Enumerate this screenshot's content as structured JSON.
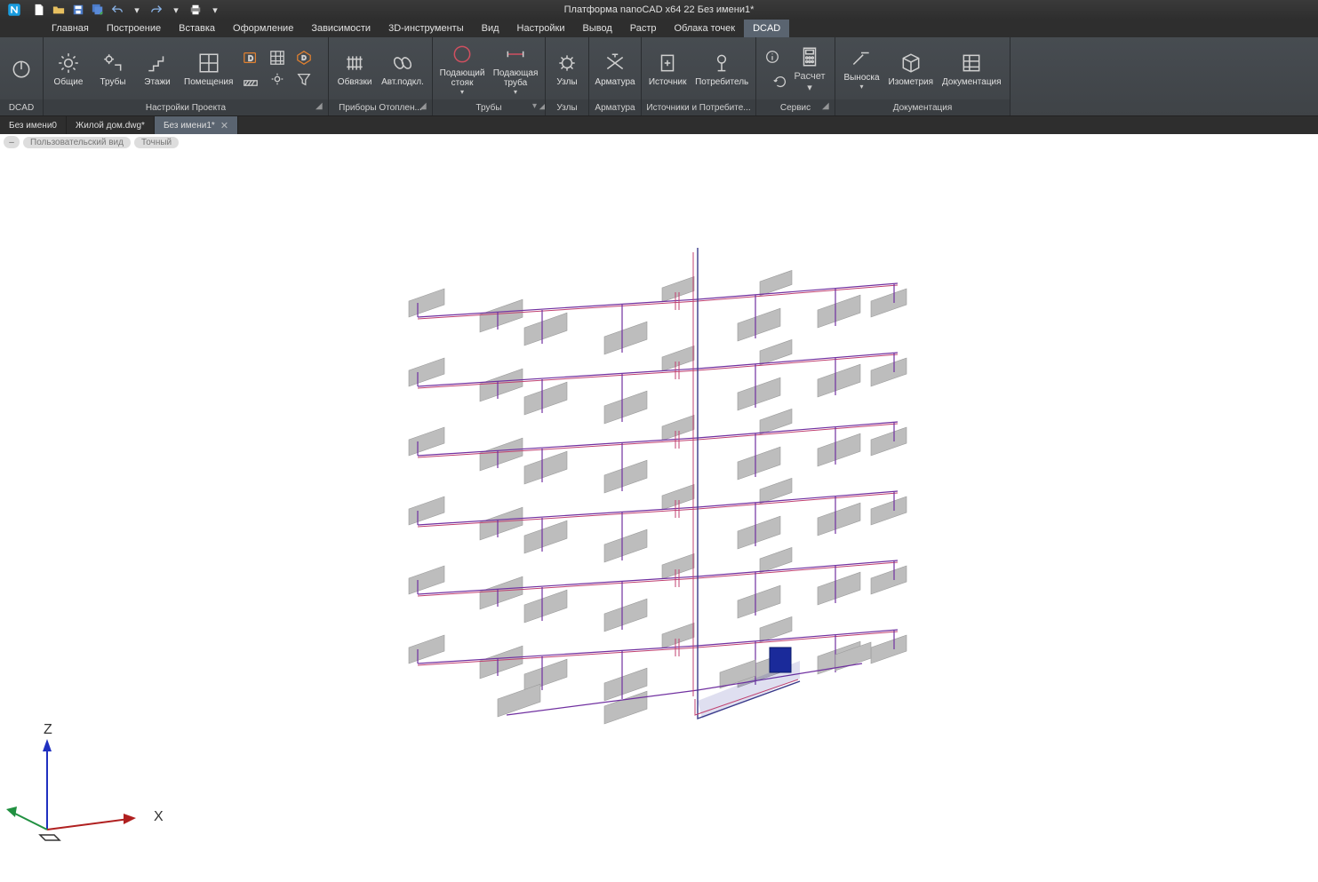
{
  "title": "Платформа nanoCAD x64 22 Без имени1*",
  "menu": [
    "Главная",
    "Построение",
    "Вставка",
    "Оформление",
    "Зависимости",
    "3D-инструменты",
    "Вид",
    "Настройки",
    "Вывод",
    "Растр",
    "Облака точек",
    "DCAD"
  ],
  "active_menu": 11,
  "ribbon": {
    "p_dcad": "DCAD",
    "p_project": "Настройки Проекта",
    "p_heaters": "Приборы Отоплен...",
    "p_pipes": "Трубы",
    "p_nodes": "Узлы",
    "p_valves": "Арматура",
    "p_srccons": "Источники и Потребите...",
    "p_service": "Сервис",
    "p_docs": "Документация",
    "b_common": "Общие",
    "b_tubes": "Трубы",
    "b_floors": "Этажи",
    "b_rooms": "Помещения",
    "b_strap": "Обвязки",
    "b_auto": "Авт.подкл.",
    "b_supplyriser": "Подающий\nстояк",
    "b_supplypipe": "Подающая\nтруба",
    "b_node": "Узлы",
    "b_valve": "Арматура",
    "b_source": "Источник",
    "b_consumer": "Потребитель",
    "b_calc": "Расчет",
    "b_leader": "Выноска",
    "b_iso": "Изометрия",
    "b_doc": "Документация"
  },
  "doctabs": [
    {
      "label": "Без имени0",
      "close": false,
      "active": false
    },
    {
      "label": "Жилой дом.dwg*",
      "close": false,
      "active": false
    },
    {
      "label": "Без имени1*",
      "close": true,
      "active": true
    }
  ],
  "viewbar": {
    "minus": "–",
    "pill1": "Пользовательский вид",
    "pill2": "Точный"
  },
  "axes": {
    "z": "Z",
    "x": "X"
  }
}
